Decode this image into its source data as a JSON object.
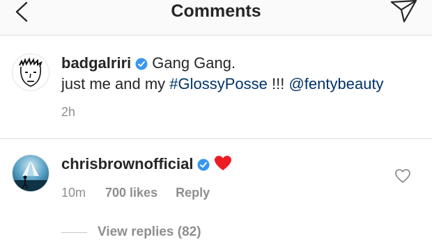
{
  "header": {
    "title": "Comments",
    "back_icon": "chevron-left-icon",
    "send_icon": "paper-plane-icon"
  },
  "caption": {
    "username": "badgalriri",
    "verified": true,
    "text_first": "Gang Gang.",
    "text_prefix": "just me and my ",
    "hashtag": "#GlossyPosse",
    "text_middle": " !!! ",
    "mention": "@fentybeauty",
    "timestamp": "2h"
  },
  "comment": {
    "username": "chrisbrownofficial",
    "verified": true,
    "emoji": "❤️",
    "timestamp": "10m",
    "likes": "700 likes",
    "reply_label": "Reply",
    "like_icon": "heart-outline-icon"
  },
  "view_replies": "View replies (82)",
  "colors": {
    "verified_badge": "#3897f0",
    "link": "#003569",
    "heart": "#ed1c24",
    "secondary_text": "#8e8e8e"
  }
}
